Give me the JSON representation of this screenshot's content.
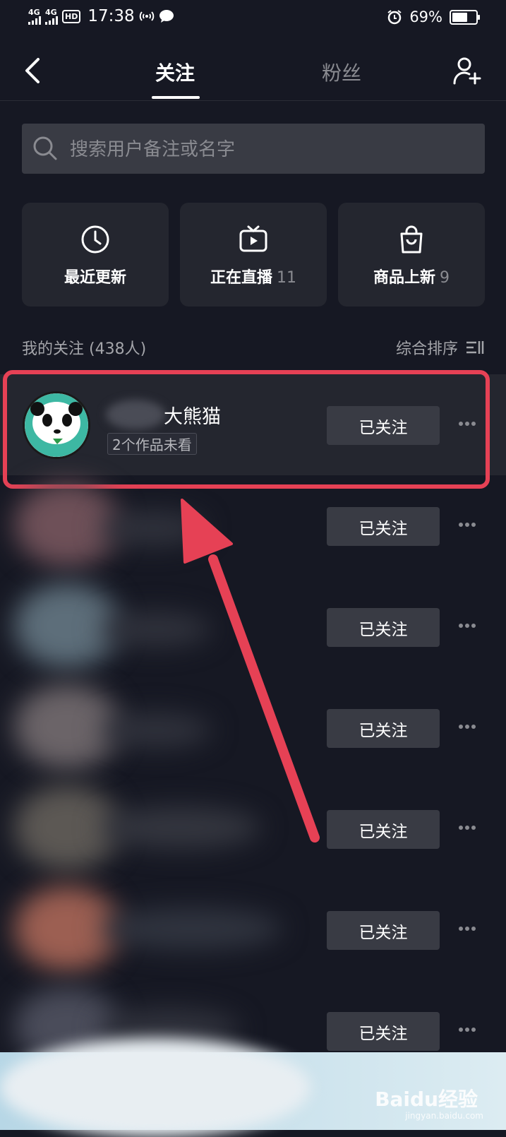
{
  "status_bar": {
    "network1": "4G",
    "network2": "4G",
    "hd": "HD",
    "time": "17:38",
    "battery": "69%",
    "battery_level": 0.69
  },
  "nav": {
    "tab_following": "关注",
    "tab_fans": "粉丝"
  },
  "search": {
    "placeholder": "搜索用户备注或名字"
  },
  "cards": [
    {
      "label": "最近更新",
      "count": ""
    },
    {
      "label": "正在直播",
      "count": "11"
    },
    {
      "label": "商品上新",
      "count": "9"
    }
  ],
  "section": {
    "title": "我的关注 (438人)",
    "sort_label": "综合排序"
  },
  "rows": [
    {
      "name": "大熊猫",
      "tag": "2个作品未看",
      "button": "已关注"
    },
    {
      "name": "",
      "tag": "",
      "button": "已关注"
    },
    {
      "name": "",
      "tag": "",
      "button": "已关注"
    },
    {
      "name": "",
      "tag": "",
      "button": "已关注"
    },
    {
      "name": "",
      "tag": "",
      "button": "已关注"
    },
    {
      "name": "",
      "tag": "",
      "button": "已关注"
    },
    {
      "name": "",
      "tag": "",
      "button": "已关注"
    }
  ],
  "watermark": {
    "brand": "Baidu经验",
    "url": "jingyan.baidu.com"
  },
  "colors": {
    "background": "#161823",
    "highlight": "#e64155",
    "button": "#393b44"
  }
}
